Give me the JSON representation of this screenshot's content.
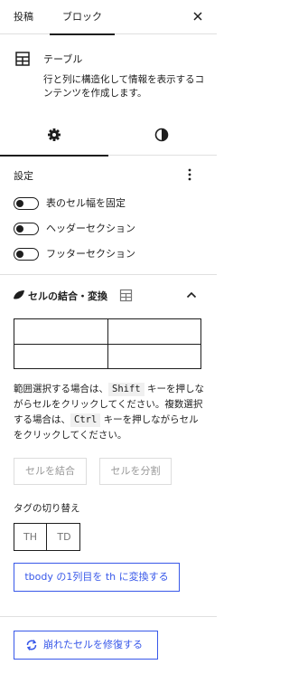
{
  "tabs": {
    "post": "投稿",
    "block": "ブロック"
  },
  "block": {
    "title": "テーブル",
    "description": "行と列に構造化して情報を表示するコンテンツを作成します。"
  },
  "settings": {
    "title": "設定",
    "toggles": [
      {
        "label": "表のセル幅を固定",
        "checked": false
      },
      {
        "label": "ヘッダーセクション",
        "checked": false
      },
      {
        "label": "フッターセクション",
        "checked": false
      }
    ]
  },
  "merge": {
    "title": "セルの結合・変換",
    "help": {
      "p1": "範囲選択する場合は、",
      "k1": "Shift",
      "p2": "キーを押しながらセルをクリックしてください。複数選択する場合は、",
      "k2": "Ctrl",
      "p3": "キーを押しながらセルをクリックしてください。"
    },
    "merge_button": "セルを結合",
    "split_button": "セルを分割",
    "tag_title": "タグの切り替え",
    "tag_th": "TH",
    "tag_td": "TD",
    "convert_button": "tbody の1列目を th に変換する",
    "repair_button": "崩れたセルを修復する"
  },
  "colors": {
    "accent": "#3858e9",
    "text": "#1e1e1e",
    "border": "#e0e0e0",
    "disabled": "#999999"
  }
}
